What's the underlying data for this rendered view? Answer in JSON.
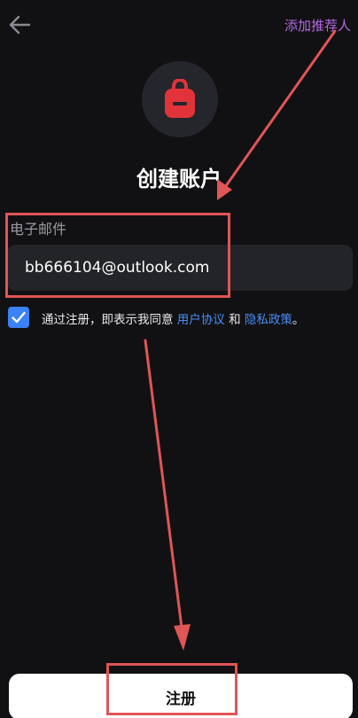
{
  "header": {
    "back_icon": "arrow-left-icon",
    "referrer_label": "添加推荐人"
  },
  "hero": {
    "icon": "backpack-icon",
    "icon_color": "#e0333a"
  },
  "page": {
    "title": "创建账户"
  },
  "form": {
    "email_label": "电子邮件",
    "email_value": "bb666104@outlook.com"
  },
  "consent": {
    "checked": true,
    "prefix": "通过注册，即表示我同意 ",
    "terms_link": "用户协议",
    "conjunction": " 和 ",
    "privacy_link": "隐私政策",
    "suffix": "。"
  },
  "footer": {
    "register_label": "注册"
  },
  "colors": {
    "background": "#111113",
    "accent_blue": "#3b82f6",
    "referrer_purple": "#b868e6",
    "annotation_red": "#e05556"
  }
}
